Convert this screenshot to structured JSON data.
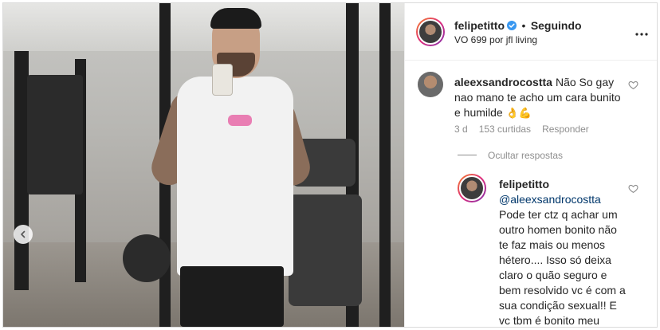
{
  "post": {
    "username": "felipetitto",
    "following_label": "Seguindo",
    "separator": "•",
    "audio_line": "VO 699 por jfl living",
    "options_icon": "more-horizontal-icon"
  },
  "comments": [
    {
      "username": "aleexsandrocostta",
      "text": "Não So gay nao mano te acho um cara bunito e humilde",
      "emoji": "👌💪",
      "time": "3 d",
      "likes": "153 curtidas",
      "reply_label": "Responder",
      "hide_replies_label": "Ocultar respostas"
    }
  ],
  "replies": [
    {
      "username": "felipetitto",
      "mention": "@aleexsandrocostta",
      "text": "Pode ter ctz q achar um outro homen bonito não te faz mais ou menos hétero.... Isso só deixa claro o quão seguro e bem resolvido vc é com a sua condição sexual!! E vc tbm é bonito meu mano.",
      "emoji": "👊👊👊"
    }
  ],
  "colors": {
    "accent_link": "#00376b",
    "verified": "#3897f0",
    "meta": "#8e8e8e"
  }
}
